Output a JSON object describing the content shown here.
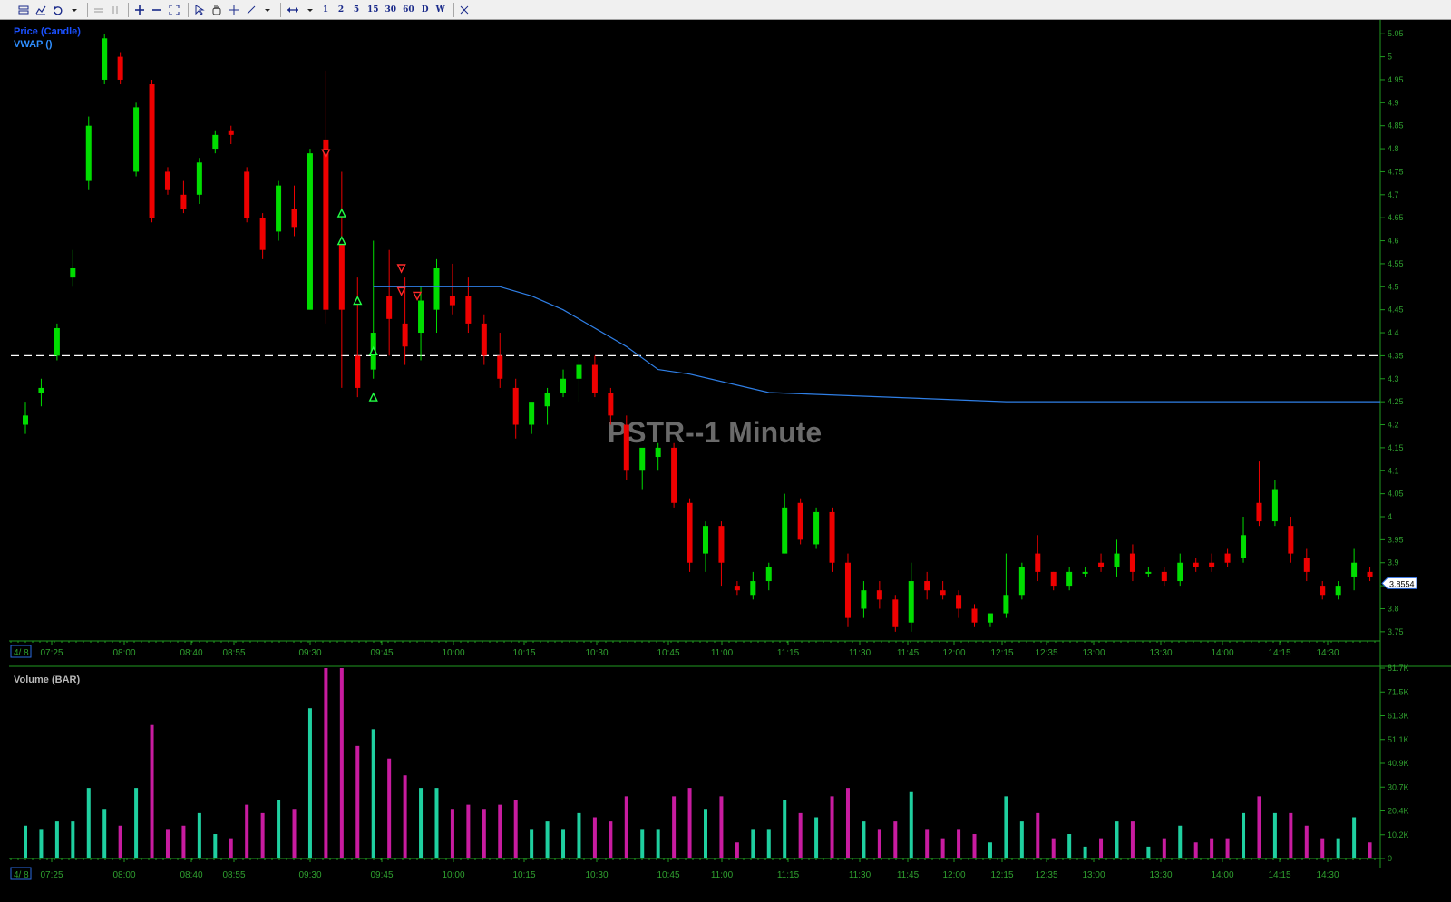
{
  "toolbar": {
    "buttons": [
      {
        "name": "chart-style-icon",
        "label": ""
      },
      {
        "name": "indicators-icon",
        "label": ""
      },
      {
        "name": "undo-icon",
        "label": ""
      },
      {
        "name": "dropdown-arrow-icon",
        "label": ""
      },
      {
        "name": "sep"
      },
      {
        "name": "lines-icon",
        "label": ""
      },
      {
        "name": "pause-icon",
        "label": ""
      },
      {
        "name": "sep"
      },
      {
        "name": "zoom-in-icon",
        "label": ""
      },
      {
        "name": "zoom-out-icon",
        "label": ""
      },
      {
        "name": "fit-icon",
        "label": ""
      },
      {
        "name": "sep"
      },
      {
        "name": "pointer-icon",
        "label": ""
      },
      {
        "name": "hand-icon",
        "label": ""
      },
      {
        "name": "crosshair-icon",
        "label": ""
      },
      {
        "name": "draw-line-icon",
        "label": ""
      },
      {
        "name": "dropdown-arrow-icon",
        "label": ""
      },
      {
        "name": "sep"
      },
      {
        "name": "scroll-icon",
        "label": ""
      },
      {
        "name": "dropdown-arrow-icon",
        "label": ""
      },
      {
        "name": "interval-1-button",
        "label": "1"
      },
      {
        "name": "interval-2-button",
        "label": "2"
      },
      {
        "name": "interval-5-button",
        "label": "5"
      },
      {
        "name": "interval-15-button",
        "label": "15"
      },
      {
        "name": "interval-30-button",
        "label": "30"
      },
      {
        "name": "interval-60-button",
        "label": "60"
      },
      {
        "name": "interval-d-button",
        "label": "D"
      },
      {
        "name": "interval-w-button",
        "label": "W"
      },
      {
        "name": "sep"
      },
      {
        "name": "close-icon",
        "label": ""
      }
    ]
  },
  "legends": {
    "price": "Price (Candle)",
    "vwap": "VWAP ()",
    "volume": "Volume (BAR)"
  },
  "watermark": "PSTR--1 Minute",
  "current_price": "3.8554",
  "date_label": "4/ 8",
  "colors": {
    "up": "#00dd00",
    "down": "#ee0000",
    "vwap": "#2f7fe6",
    "grid_text": "#2fa02f",
    "axis": "#1f9a1f",
    "price_legend": "#1a50ff",
    "vwap_legend": "#2f8fff",
    "volume_legend": "#b8b8b8",
    "watermark": "#6a6a6a",
    "vol_up": "#1fd0a0",
    "vol_down": "#c81ca0",
    "vol_flat": "#2020e0"
  },
  "chart_data": {
    "type": "candlestick",
    "symbol": "PSTR",
    "interval": "1 Minute",
    "x_tick_labels": [
      "07:25",
      "08:00",
      "08:40",
      "08:55",
      "09:30",
      "09:45",
      "10:00",
      "10:15",
      "10:30",
      "10:45",
      "11:00",
      "11:15",
      "11:30",
      "11:45",
      "12:00",
      "12:15",
      "12:35",
      "13:00",
      "13:30",
      "14:00",
      "14:15",
      "14:30"
    ],
    "y_tick_labels": [
      "5.05",
      "5",
      "4.95",
      "4.9",
      "4.85",
      "4.8",
      "4.75",
      "4.7",
      "4.65",
      "4.6",
      "4.55",
      "4.5",
      "4.45",
      "4.4",
      "4.35",
      "4.3",
      "4.25",
      "4.2",
      "4.15",
      "4.1",
      "4.05",
      "4",
      "3.95",
      "3.9",
      "3.85",
      "3.8",
      "3.75"
    ],
    "ylim": [
      3.73,
      5.08
    ],
    "reference_line": 4.35,
    "volume_tick_labels": [
      "0",
      "10.2K",
      "20.4K",
      "30.7K",
      "40.9K",
      "51.1K",
      "61.3K",
      "71.5K",
      "81.7K"
    ],
    "volume_max": 81700,
    "vwap_segments": [
      [
        0,
        4.5
      ],
      [
        8,
        4.5
      ],
      [
        10,
        4.48
      ],
      [
        12,
        4.45
      ],
      [
        16,
        4.37
      ],
      [
        18,
        4.32
      ],
      [
        20,
        4.31
      ],
      [
        25,
        4.27
      ],
      [
        40,
        4.25
      ],
      [
        50,
        4.25
      ]
    ],
    "candles": [
      [
        4.2,
        4.25,
        4.22,
        4.18
      ],
      [
        4.27,
        4.3,
        4.28,
        4.24
      ],
      [
        4.35,
        4.42,
        4.41,
        4.34
      ],
      [
        4.52,
        4.58,
        4.54,
        4.5
      ],
      [
        4.73,
        4.87,
        4.85,
        4.71
      ],
      [
        4.95,
        5.05,
        5.04,
        4.94
      ],
      [
        5.0,
        5.01,
        4.95,
        4.94
      ],
      [
        4.75,
        4.9,
        4.89,
        4.74
      ],
      [
        4.94,
        4.95,
        4.65,
        4.64
      ],
      [
        4.75,
        4.76,
        4.71,
        4.7
      ],
      [
        4.7,
        4.73,
        4.67,
        4.66
      ],
      [
        4.7,
        4.78,
        4.77,
        4.68
      ],
      [
        4.8,
        4.84,
        4.83,
        4.79
      ],
      [
        4.84,
        4.85,
        4.83,
        4.81
      ],
      [
        4.75,
        4.76,
        4.65,
        4.64
      ],
      [
        4.65,
        4.66,
        4.58,
        4.56
      ],
      [
        4.62,
        4.73,
        4.72,
        4.6
      ],
      [
        4.67,
        4.72,
        4.63,
        4.61
      ],
      [
        4.45,
        4.8,
        4.79,
        4.45
      ],
      [
        4.82,
        4.97,
        4.45,
        4.42
      ],
      [
        4.6,
        4.75,
        4.45,
        4.28
      ],
      [
        4.35,
        4.52,
        4.28,
        4.26
      ],
      [
        4.32,
        4.6,
        4.4,
        4.3
      ],
      [
        4.48,
        4.58,
        4.43,
        4.35
      ],
      [
        4.42,
        4.52,
        4.37,
        4.33
      ],
      [
        4.4,
        4.5,
        4.47,
        4.34
      ],
      [
        4.45,
        4.56,
        4.54,
        4.4
      ],
      [
        4.48,
        4.55,
        4.46,
        4.44
      ],
      [
        4.48,
        4.52,
        4.42,
        4.4
      ],
      [
        4.42,
        4.44,
        4.35,
        4.33
      ],
      [
        4.35,
        4.4,
        4.3,
        4.28
      ],
      [
        4.28,
        4.3,
        4.2,
        4.17
      ],
      [
        4.2,
        4.24,
        4.25,
        4.18
      ],
      [
        4.24,
        4.28,
        4.27,
        4.2
      ],
      [
        4.27,
        4.32,
        4.3,
        4.26
      ],
      [
        4.3,
        4.35,
        4.33,
        4.25
      ],
      [
        4.33,
        4.35,
        4.27,
        4.26
      ],
      [
        4.27,
        4.28,
        4.22,
        4.2
      ],
      [
        4.2,
        4.22,
        4.1,
        4.08
      ],
      [
        4.1,
        4.12,
        4.15,
        4.06
      ],
      [
        4.13,
        4.16,
        4.15,
        4.1
      ],
      [
        4.15,
        4.16,
        4.03,
        4.02
      ],
      [
        4.03,
        4.04,
        3.9,
        3.88
      ],
      [
        3.92,
        3.99,
        3.98,
        3.88
      ],
      [
        3.98,
        3.99,
        3.9,
        3.85
      ],
      [
        3.85,
        3.86,
        3.84,
        3.83
      ],
      [
        3.83,
        3.88,
        3.86,
        3.82
      ],
      [
        3.86,
        3.9,
        3.89,
        3.84
      ],
      [
        3.92,
        4.05,
        4.02,
        3.92
      ],
      [
        4.03,
        4.04,
        3.95,
        3.94
      ],
      [
        3.94,
        4.02,
        4.01,
        3.93
      ],
      [
        4.01,
        4.02,
        3.9,
        3.88
      ],
      [
        3.9,
        3.92,
        3.78,
        3.76
      ],
      [
        3.8,
        3.86,
        3.84,
        3.78
      ],
      [
        3.84,
        3.86,
        3.82,
        3.8
      ],
      [
        3.82,
        3.83,
        3.76,
        3.75
      ],
      [
        3.77,
        3.9,
        3.86,
        3.75
      ],
      [
        3.86,
        3.88,
        3.84,
        3.82
      ],
      [
        3.84,
        3.86,
        3.83,
        3.82
      ],
      [
        3.83,
        3.84,
        3.8,
        3.78
      ],
      [
        3.8,
        3.81,
        3.77,
        3.76
      ],
      [
        3.77,
        3.79,
        3.79,
        3.76
      ],
      [
        3.79,
        3.92,
        3.83,
        3.78
      ],
      [
        3.83,
        3.9,
        3.89,
        3.82
      ],
      [
        3.92,
        3.96,
        3.88,
        3.86
      ],
      [
        3.88,
        3.88,
        3.85,
        3.84
      ],
      [
        3.85,
        3.89,
        3.88,
        3.84
      ],
      [
        3.88,
        3.89,
        3.88,
        3.87
      ],
      [
        3.9,
        3.92,
        3.89,
        3.88
      ],
      [
        3.89,
        3.95,
        3.92,
        3.87
      ],
      [
        3.92,
        3.94,
        3.88,
        3.86
      ],
      [
        3.88,
        3.89,
        3.88,
        3.87
      ],
      [
        3.88,
        3.89,
        3.86,
        3.85
      ],
      [
        3.86,
        3.92,
        3.9,
        3.85
      ],
      [
        3.9,
        3.91,
        3.89,
        3.88
      ],
      [
        3.9,
        3.92,
        3.89,
        3.88
      ],
      [
        3.92,
        3.93,
        3.9,
        3.89
      ],
      [
        3.91,
        4.0,
        3.96,
        3.9
      ],
      [
        4.03,
        4.12,
        3.99,
        3.98
      ],
      [
        3.99,
        4.08,
        4.06,
        3.98
      ],
      [
        3.98,
        4.0,
        3.92,
        3.9
      ],
      [
        3.91,
        3.93,
        3.88,
        3.86
      ],
      [
        3.85,
        3.86,
        3.83,
        3.82
      ],
      [
        3.83,
        3.86,
        3.85,
        3.82
      ],
      [
        3.87,
        3.93,
        3.9,
        3.84
      ],
      [
        3.88,
        3.89,
        3.87,
        3.86
      ]
    ],
    "volume_bars": []
  }
}
